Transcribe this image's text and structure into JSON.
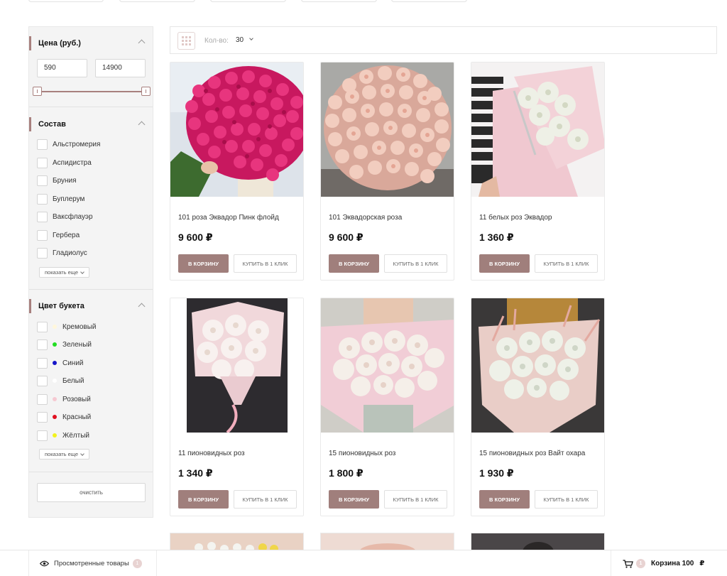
{
  "filters": {
    "price": {
      "title": "Цена (руб.)",
      "min_value": "590",
      "max_value": "14900"
    },
    "composition": {
      "title": "Состав",
      "items": [
        "Альстромерия",
        "Аспидистра",
        "Бруния",
        "Буплерум",
        "Ваксфлауэр",
        "Гербера",
        "Гладиолус"
      ],
      "show_more": "показать еще"
    },
    "color": {
      "title": "Цвет букета",
      "items": [
        {
          "label": "Кремовый",
          "color": "#fff7dc"
        },
        {
          "label": "Зеленый",
          "color": "#22dd22"
        },
        {
          "label": "Синий",
          "color": "#1515c8"
        },
        {
          "label": "Белый",
          "color": "#ffffff"
        },
        {
          "label": "Розовый",
          "color": "#f6c9d2"
        },
        {
          "label": "Красный",
          "color": "#e01020"
        },
        {
          "label": "Жёлтый",
          "color": "#f2f21e"
        }
      ],
      "show_more": "показать еще"
    },
    "clear_label": "очистить"
  },
  "toolbar": {
    "qty_label": "Кол-во:",
    "qty_value": "30"
  },
  "products": [
    {
      "name": "101 роза Эквадор Пинк флойд",
      "price": "9 600 ₽"
    },
    {
      "name": "101 Эквадорская роза",
      "price": "9 600 ₽"
    },
    {
      "name": "11 белых роз Эквадор",
      "price": "1 360 ₽"
    },
    {
      "name": "11 пионовидных роз",
      "price": "1 340 ₽"
    },
    {
      "name": "15 пионовидных роз",
      "price": "1 800 ₽"
    },
    {
      "name": "15 пионовидных роз Вайт охара",
      "price": "1 930 ₽"
    }
  ],
  "buttons": {
    "add_to_cart": "В КОРЗИНУ",
    "one_click": "КУПИТЬ В 1 КЛИК"
  },
  "bottom_bar": {
    "viewed_label": "Просмотренные товары",
    "viewed_count": "1",
    "cart_count": "1",
    "cart_label": "Корзина 100",
    "currency": "₽"
  },
  "colors": {
    "accent": "#a07f7c",
    "sidebar_bg": "#f4f4f4"
  }
}
